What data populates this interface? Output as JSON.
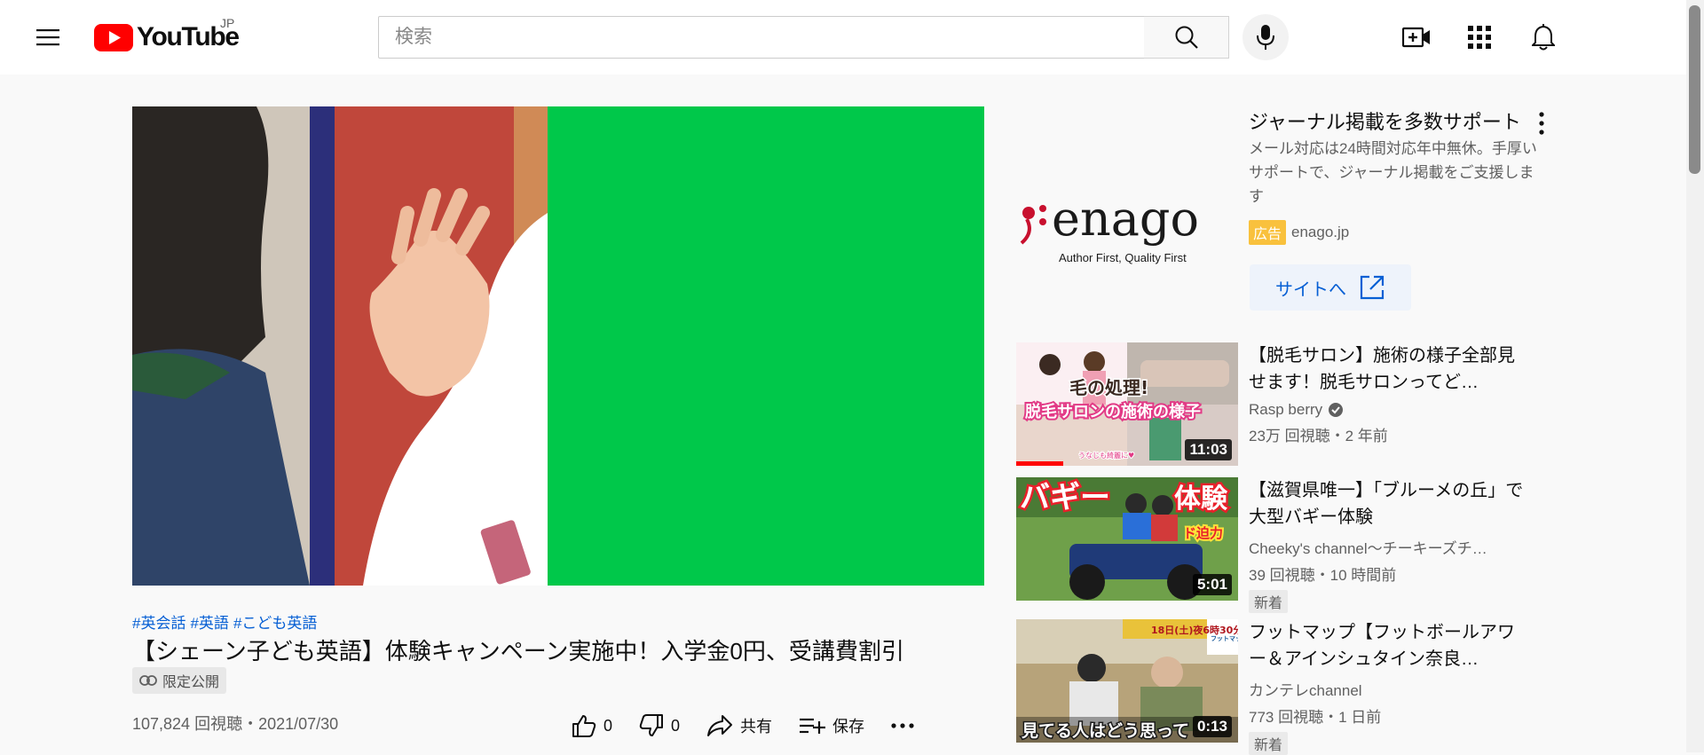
{
  "header": {
    "logo_text": "YouTube",
    "region": "JP",
    "search_placeholder": "検索"
  },
  "video": {
    "hashtags": [
      "#英会話",
      "#英語",
      "#こども英語"
    ],
    "title": "【シェーン子ども英語】体験キャンペーン実施中！入学金0円、受講費割引",
    "privacy_label": "限定公開",
    "stats": "107,824 回視聴・2021/07/30",
    "likes": "0",
    "dislikes": "0",
    "share_label": "共有",
    "save_label": "保存"
  },
  "ad": {
    "logo_text": "enago",
    "logo_tagline": "Author First, Quality First",
    "title": "ジャーナル掲載を多数サポート",
    "description": "メール対応は24時間対応年中無休。手厚いサポートで、ジャーナル掲載をご支援します",
    "badge": "広告",
    "domain": "enago.jp",
    "cta_label": "サイトへ"
  },
  "recommendations": [
    {
      "title": "【脱毛サロン】施術の様子全部見せます！脱毛サロンってど…",
      "channel": "Rasp berry",
      "verified": true,
      "views": "23万 回視聴・2 年前",
      "duration": "11:03",
      "is_new": false,
      "watched_fraction": 0.21,
      "thumb_text_1": "毛の処理!",
      "thumb_text_2": "脱毛サロンの施術の様子",
      "thumb_text_3": "うなじも綺麗に♥"
    },
    {
      "title": "【滋賀県唯一】「ブルーメの丘」で大型バギー体験",
      "channel": "Cheeky's channel〜チーキーズチ…",
      "verified": false,
      "views": "39 回視聴・10 時間前",
      "duration": "5:01",
      "is_new": true,
      "new_label": "新着",
      "thumb_text_1": "バギー",
      "thumb_text_2": "体験",
      "thumb_text_3": "ド迫力"
    },
    {
      "title": "フットマップ【フットボールアワー＆アインシュタイン奈良…",
      "channel": "カンテレchannel",
      "verified": false,
      "views": "773 回視聴・1 日前",
      "duration": "0:13",
      "is_new": true,
      "new_label": "新着",
      "thumb_text_1": "18日(土)夜6時30分",
      "thumb_text_2": "見てる人はどう思って",
      "thumb_text_3": "フットマップ"
    }
  ],
  "colors": {
    "brand_red": "#ff0000",
    "link_blue": "#065fd4",
    "player_green": "#00c84a",
    "ad_badge": "#f9c13d"
  },
  "icons": {
    "menu": "hamburger-icon",
    "search": "search-icon",
    "mic": "microphone-icon",
    "create": "video-plus-icon",
    "apps": "apps-grid-icon",
    "notifications": "bell-icon",
    "like": "thumbs-up-icon",
    "dislike": "thumbs-down-icon",
    "share": "share-arrow-icon",
    "save": "playlist-add-icon",
    "more": "more-horizontal-icon",
    "ad_more": "more-vertical-icon",
    "external": "external-link-icon",
    "verified": "verified-check-icon",
    "link": "link-icon"
  }
}
